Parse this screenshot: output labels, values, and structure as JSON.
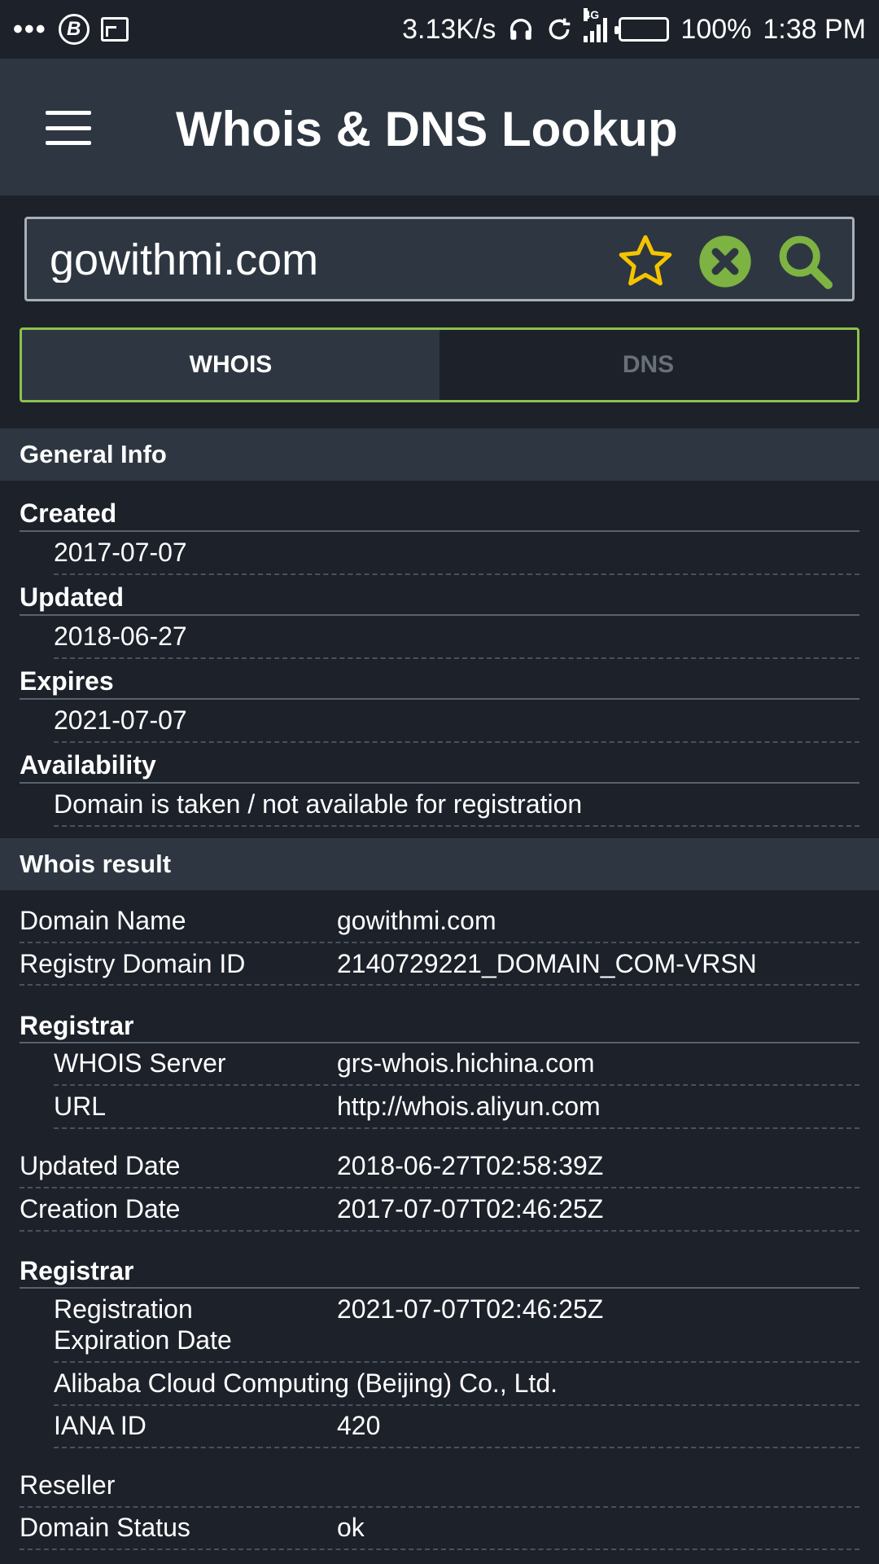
{
  "status_bar": {
    "speed": "3.13K/s",
    "network": "4G",
    "battery": "100%",
    "time": "1:38 PM",
    "badge_letter": "B"
  },
  "app_bar": {
    "title": "Whois & DNS Lookup"
  },
  "search": {
    "value": "gowithmi.com"
  },
  "tabs": {
    "whois": "WHOIS",
    "dns": "DNS",
    "selected": "WHOIS"
  },
  "colors": {
    "accent": "#8bc34a",
    "star": "#f5c400",
    "background": "#1c212a",
    "header": "#2e3741"
  },
  "general_info": {
    "header": "General Info",
    "created_label": "Created",
    "created_value": "2017-07-07",
    "updated_label": "Updated",
    "updated_value": "2018-06-27",
    "expires_label": "Expires",
    "expires_value": "2021-07-07",
    "availability_label": "Availability",
    "availability_value": "Domain is taken / not available for registration"
  },
  "whois_result": {
    "header": "Whois result",
    "domain_name_key": "Domain Name",
    "domain_name_val": "gowithmi.com",
    "registry_id_key": "Registry Domain ID",
    "registry_id_val": "2140729221_DOMAIN_COM-VRSN",
    "registrar1_label": "Registrar",
    "whois_server_key": "WHOIS Server",
    "whois_server_val": "grs-whois.hichina.com",
    "url_key": "URL",
    "url_val": "http://whois.aliyun.com",
    "updated_date_key": "Updated Date",
    "updated_date_val": "2018-06-27T02:58:39Z",
    "creation_date_key": "Creation Date",
    "creation_date_val": "2017-07-07T02:46:25Z",
    "registrar2_label": "Registrar",
    "reg_exp_key_line1": "Registration",
    "reg_exp_key_line2": "Expiration Date",
    "reg_exp_val": "2021-07-07T02:46:25Z",
    "registrar_name": "Alibaba Cloud Computing (Beijing) Co., Ltd.",
    "iana_key": "IANA ID",
    "iana_val": "420",
    "reseller_key": "Reseller",
    "domain_status_key": "Domain Status",
    "domain_status_val": "ok"
  }
}
